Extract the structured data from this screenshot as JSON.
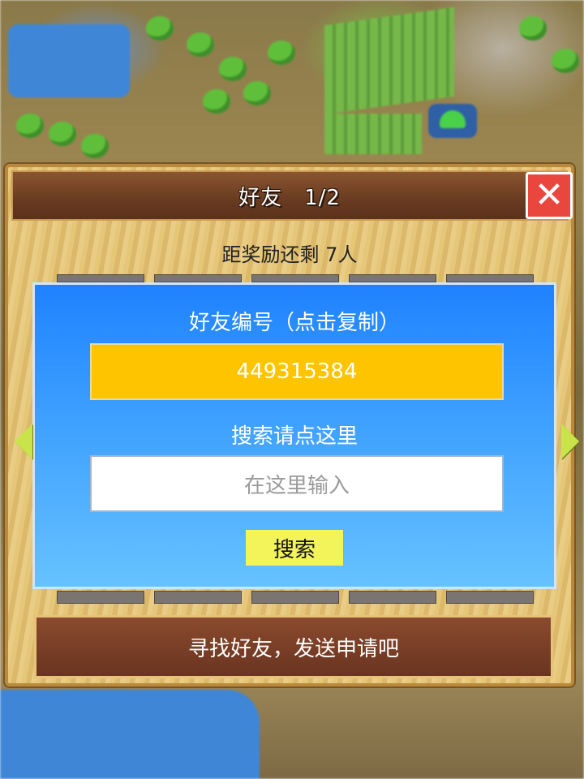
{
  "dialog": {
    "title": "好友　1/2",
    "reward_text": "距奖励还剩 7人",
    "close_icon": "close-icon"
  },
  "panel": {
    "friend_id_label": "好友编号（点击复制）",
    "friend_id": "449315384",
    "search_label": "搜索请点这里",
    "search_placeholder": "在这里输入",
    "search_button": "搜索"
  },
  "footer": {
    "button_label": "寻找好友，发送申请吧"
  },
  "nav": {
    "prev_icon": "arrow-left-icon",
    "next_icon": "arrow-right-icon"
  },
  "colors": {
    "title_bar": "#6b3d22",
    "panel_blue": "#3ea0ff",
    "id_box": "#ffc400",
    "search_button": "#f3f35a",
    "close_button": "#e9463d",
    "nav_arrow": "#c9e44a"
  }
}
